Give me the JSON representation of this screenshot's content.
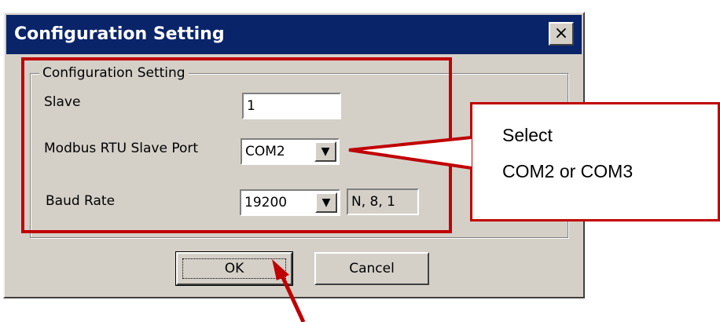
{
  "dialog": {
    "title": "Configuration Setting",
    "close_glyph": "×",
    "group_title": "Configuration Setting",
    "fields": {
      "slave_label": "Slave",
      "slave_value": "1",
      "port_label": "Modbus RTU Slave Port",
      "port_value": "COM2",
      "baud_label": "Baud Rate",
      "baud_value": "19200",
      "format_value": "N, 8, 1"
    },
    "buttons": {
      "ok": "OK",
      "cancel": "Cancel"
    }
  },
  "annotation": {
    "line1": "Select",
    "line2": "COM2 or COM3",
    "color": "#c00000"
  },
  "icons": {
    "dropdown": "chevron-down-icon",
    "close": "close-icon"
  }
}
